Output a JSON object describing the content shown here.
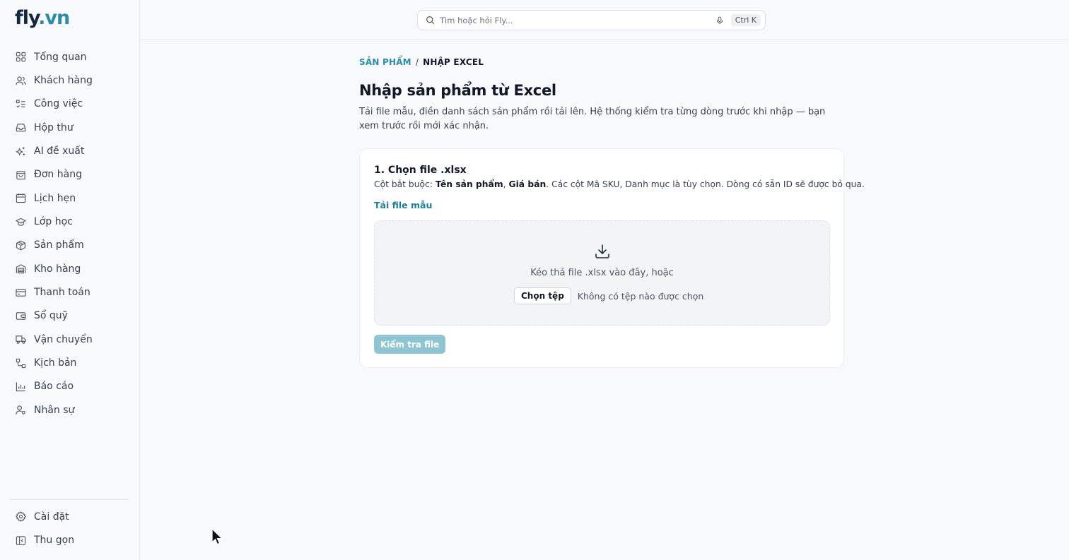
{
  "brand": {
    "logo_a": "fly",
    "logo_b": ".vn"
  },
  "search": {
    "placeholder": "Tìm hoặc hỏi Fly...",
    "shortcut": "Ctrl K"
  },
  "sidebar": {
    "items": [
      {
        "label": "Tổng quan",
        "icon": "grid-icon"
      },
      {
        "label": "Khách hàng",
        "icon": "users-icon"
      },
      {
        "label": "Công việc",
        "icon": "checklist-icon"
      },
      {
        "label": "Hộp thư",
        "icon": "inbox-icon"
      },
      {
        "label": "AI đề xuất",
        "icon": "sparkles-icon"
      },
      {
        "label": "Đơn hàng",
        "icon": "shopping-bag-icon"
      },
      {
        "label": "Lịch hẹn",
        "icon": "calendar-icon"
      },
      {
        "label": "Lớp học",
        "icon": "graduation-cap-icon"
      },
      {
        "label": "Sản phẩm",
        "icon": "package-icon"
      },
      {
        "label": "Kho hàng",
        "icon": "warehouse-icon"
      },
      {
        "label": "Thanh toán",
        "icon": "credit-card-icon"
      },
      {
        "label": "Sổ quỹ",
        "icon": "wallet-icon"
      },
      {
        "label": "Vận chuyển",
        "icon": "truck-icon"
      },
      {
        "label": "Kịch bản",
        "icon": "workflow-icon"
      },
      {
        "label": "Báo cáo",
        "icon": "bar-chart-icon"
      },
      {
        "label": "Nhân sự",
        "icon": "user-cog-icon"
      }
    ],
    "settings_label": "Cài đặt",
    "collapse_label": "Thu gọn"
  },
  "breadcrumb": {
    "parent": "SẢN PHẨM",
    "separator": "/",
    "current": "NHẬP EXCEL"
  },
  "page": {
    "title": "Nhập sản phẩm từ Excel",
    "description": "Tải file mẫu, điền danh sách sản phẩm rồi tải lên. Hệ thống kiểm tra từng dòng trước khi nhập — bạn xem trước rồi mới xác nhận."
  },
  "step1": {
    "title": "1. Chọn file .xlsx",
    "req_prefix": "Cột bắt buộc: ",
    "req_col1": "Tên sản phẩm",
    "req_comma": ", ",
    "req_col2": "Giá bán",
    "req_suffix": ". Các cột Mã SKU, Danh mục là tùy chọn. Dòng có sẵn ID sẽ được bỏ qua.",
    "download_link": "Tải file mẫu",
    "drop_text": "Kéo thả file .xlsx vào đây, hoặc",
    "choose_button": "Chọn tệp",
    "no_file": "Không có tệp nào được chọn",
    "check_button": "Kiểm tra file"
  },
  "colors": {
    "accent": "#2a8ca6",
    "button_disabled": "#8fc4d2"
  }
}
